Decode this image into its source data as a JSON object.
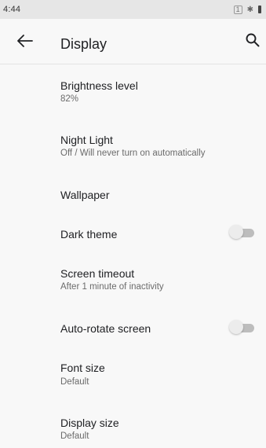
{
  "status_bar": {
    "time": "4:44",
    "notification_badge": "1",
    "bluetooth_glyph": "✱",
    "icons": [
      "notification-icon",
      "bluetooth-icon",
      "battery-icon"
    ]
  },
  "app_bar": {
    "title": "Display",
    "back_icon": "arrow-back-icon",
    "search_icon": "search-icon"
  },
  "settings": [
    {
      "title": "Brightness level",
      "summary": "82%"
    },
    {
      "title": "Night Light",
      "summary": "Off / Will never turn on automatically"
    },
    {
      "title": "Wallpaper"
    },
    {
      "title": "Dark theme",
      "toggle": false
    },
    {
      "title": "Screen timeout",
      "summary": "After 1 minute of inactivity"
    },
    {
      "title": "Auto-rotate screen",
      "toggle": false
    },
    {
      "title": "Font size",
      "summary": "Default"
    },
    {
      "title": "Display size",
      "summary": "Default"
    }
  ],
  "colors": {
    "background": "#f8f8f8",
    "status_bar": "#e6e6e6",
    "title_text": "#202124",
    "summary_text": "#6b6b6b",
    "toggle_off_track": "#bdbdbd",
    "toggle_off_thumb": "#ececec"
  }
}
